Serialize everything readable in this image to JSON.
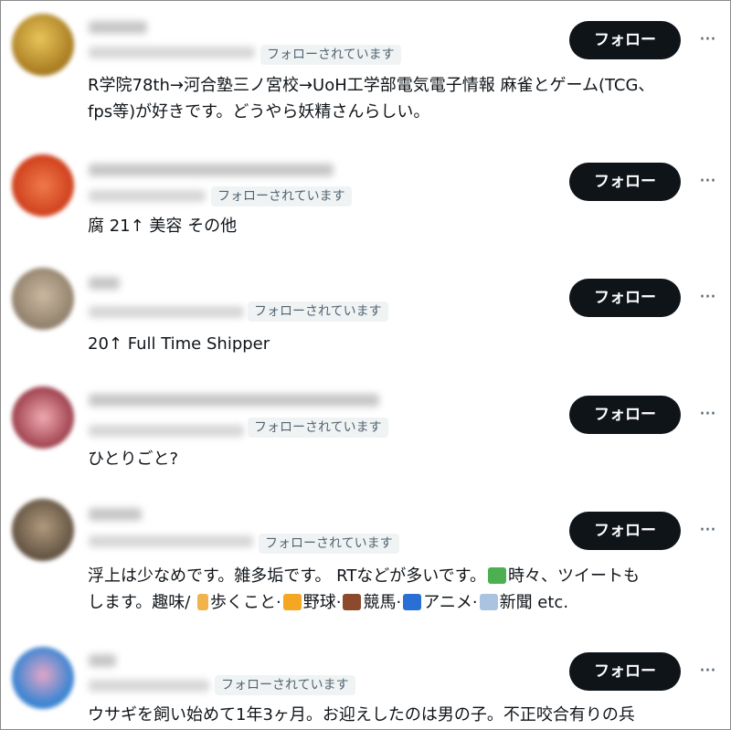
{
  "users": [
    {
      "badge": "フォローされています",
      "follow_label": "フォロー",
      "more_label": "···",
      "bio_lines": [
        "R学院78th→河合塾三ノ宮校→UoH工学部電気電子情報 麻雀とゲーム(TCG、",
        "fps等)が好きです。どうやら妖精さんらしい。"
      ],
      "avatar_color": "#c9a13a"
    },
    {
      "badge": "フォローされています",
      "follow_label": "フォロー",
      "more_label": "···",
      "bio_lines": [
        "腐 21↑ 美容 その他"
      ],
      "avatar_color": "#d9532a"
    },
    {
      "badge": "フォローされています",
      "follow_label": "フォロー",
      "more_label": "···",
      "bio_lines": [
        "20↑ Full Time Shipper"
      ],
      "avatar_color": "#b0a08a"
    },
    {
      "badge": "フォローされています",
      "follow_label": "フォロー",
      "more_label": "···",
      "bio_lines": [
        "ひとりごと?"
      ],
      "avatar_color": "#c4747f"
    },
    {
      "badge": "フォローされています",
      "follow_label": "フォロー",
      "more_label": "···",
      "bio_lines": [
        "浮上は少なめです。雑多垢です。 RTなどが多いです。",
        "します。趣味/"
      ],
      "bio_extra": {
        "line1_tail": "時々、ツイートも",
        "walk": "歩くこと·",
        "baseball": "野球·",
        "horse": "競馬·",
        "anime": "アニメ·",
        "news": "新聞 etc."
      },
      "avatar_color": "#8c7a62"
    },
    {
      "badge": "フォローされています",
      "follow_label": "フォロー",
      "more_label": "···",
      "bio_lines": [
        "ウサギを飼い始めて1年3ヶ月。お迎えしたのは男の子。不正咬合有りの兵"
      ],
      "avatar_color": "#5f9bd4"
    }
  ],
  "emoji_icons": [
    "sparkle-icon",
    "walking-person-icon",
    "tiger-face-icon",
    "horse-icon",
    "television-icon",
    "newspaper-icon"
  ]
}
